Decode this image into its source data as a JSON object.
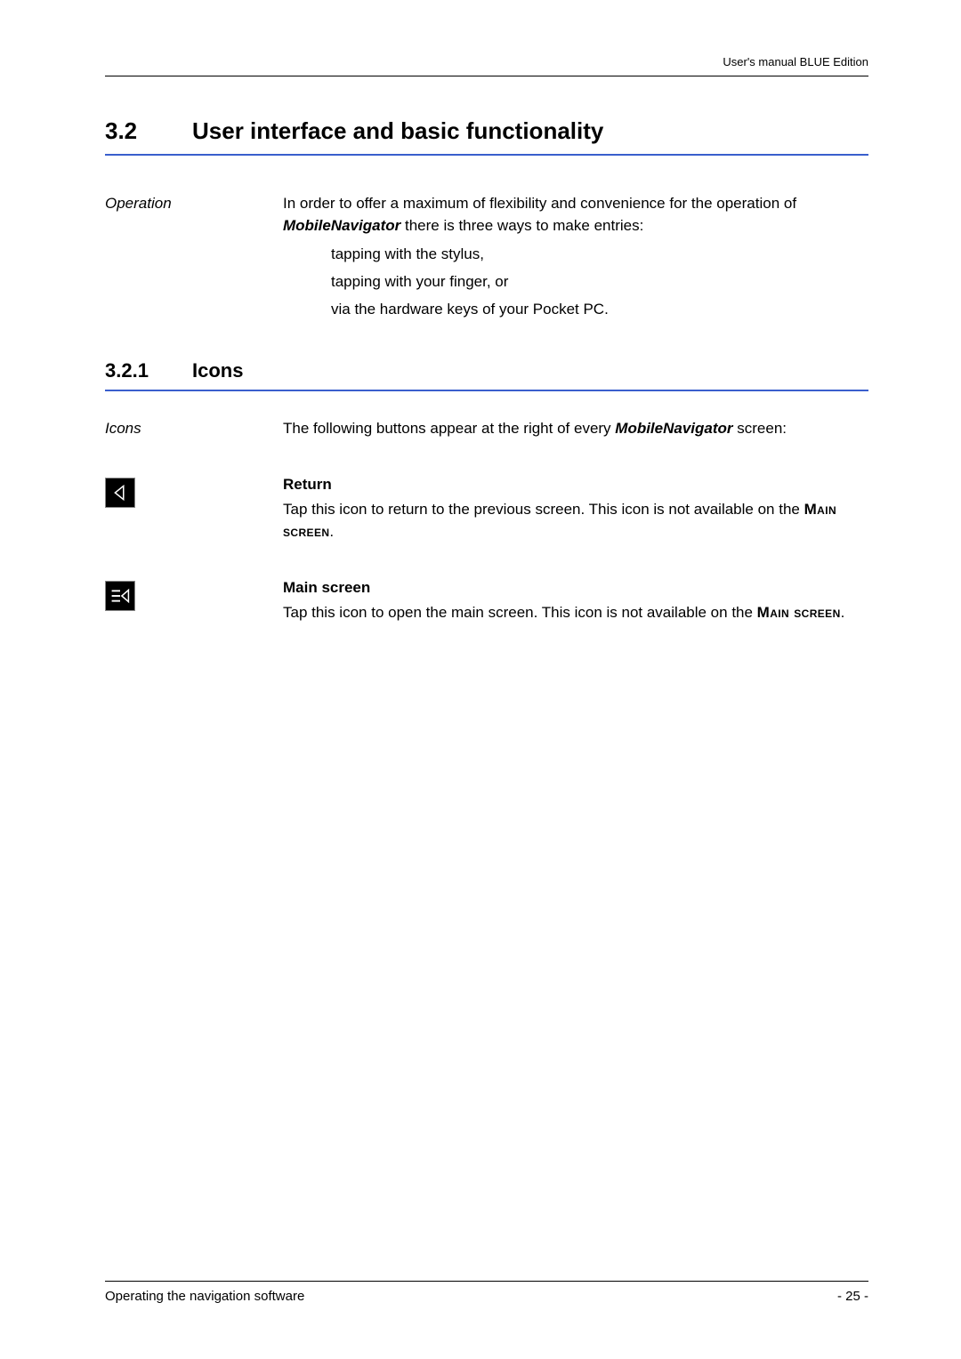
{
  "header": {
    "right": "User's manual BLUE Edition"
  },
  "section": {
    "num": "3.2",
    "title": "User interface and basic functionality"
  },
  "operation": {
    "label": "Operation",
    "intro_a": "In order to offer a maximum of flexibility and convenience for the operation of ",
    "intro_b": "MobileNavigator",
    "intro_c": " there is three ways to make entries:",
    "items": [
      "tapping with the stylus,",
      "tapping with your finger, or",
      "via the hardware keys of your Pocket PC."
    ]
  },
  "subsection": {
    "num": "3.2.1",
    "title": "Icons"
  },
  "icons_intro": {
    "label": "Icons",
    "text_a": "The following buttons appear at the right of every ",
    "text_b": "MobileNavigator",
    "text_c": " screen:"
  },
  "return_block": {
    "heading": "Return",
    "text_a": "Tap this icon to return to the previous screen. This icon is not available on the ",
    "text_b": "Main screen",
    "text_c": "."
  },
  "main_block": {
    "heading": "Main screen",
    "text_a": "Tap this icon to open the main screen. This icon is not available on the ",
    "text_b": "Main screen",
    "text_c": "."
  },
  "footer": {
    "left": "Operating the navigation software",
    "right": "- 25 -"
  }
}
